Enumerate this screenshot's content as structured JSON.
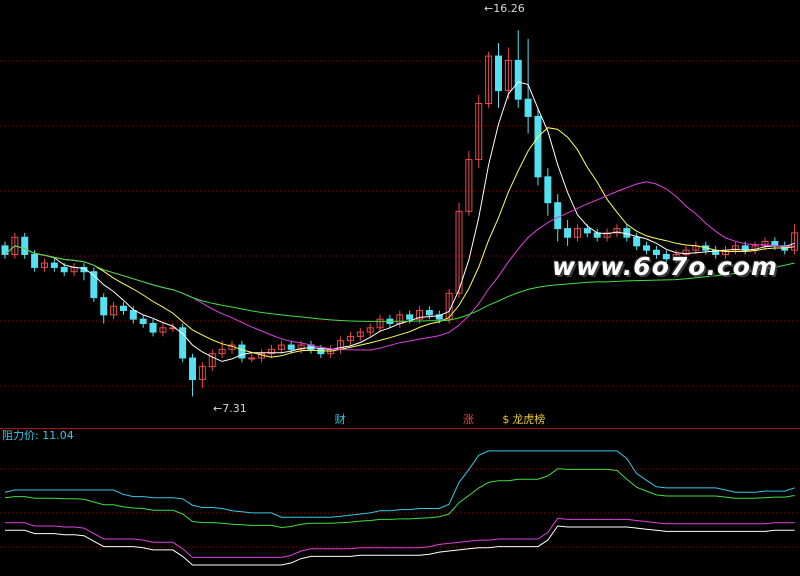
{
  "chart_data": {
    "type": "candlestick",
    "title": "",
    "price_range": [
      6.6,
      16.5
    ],
    "indicator": {
      "label": "阻力价",
      "value": "11.04",
      "range": [
        0,
        12.5
      ]
    },
    "annotations": {
      "high": "16.26",
      "low": "7.31"
    },
    "markers": [
      {
        "text": "财",
        "index": 34,
        "color": "#36c8e8"
      },
      {
        "text": "涨",
        "index": 47,
        "color": "#e84c4c"
      },
      {
        "text": "$",
        "index": 51,
        "color": "#e8c832"
      },
      {
        "text": "龙虎榜",
        "index": 52,
        "color": "#e8c832"
      }
    ],
    "series": [
      {
        "values": [
          [
            10.8,
            10.6,
            10.9,
            10.5
          ],
          [
            10.6,
            11.0,
            11.1,
            10.5
          ],
          [
            11.0,
            10.6,
            11.1,
            10.5
          ],
          [
            10.6,
            10.3,
            10.7,
            10.2
          ],
          [
            10.3,
            10.4,
            10.5,
            10.2
          ],
          [
            10.4,
            10.3,
            10.5,
            10.2
          ],
          [
            10.3,
            10.2,
            10.4,
            10.1
          ],
          [
            10.2,
            10.3,
            10.4,
            10.1
          ],
          [
            10.3,
            10.2,
            10.4,
            10.0
          ],
          [
            10.2,
            9.6,
            10.3,
            9.5
          ],
          [
            9.6,
            9.2,
            9.7,
            9.0
          ],
          [
            9.2,
            9.4,
            9.5,
            9.1
          ],
          [
            9.4,
            9.3,
            9.5,
            9.2
          ],
          [
            9.3,
            9.1,
            9.4,
            9.0
          ],
          [
            9.1,
            9.0,
            9.2,
            8.9
          ],
          [
            9.0,
            8.8,
            9.1,
            8.7
          ],
          [
            8.8,
            8.9,
            9.0,
            8.7
          ],
          [
            8.9,
            8.9,
            9.0,
            8.8
          ],
          [
            8.9,
            8.2,
            9.0,
            8.1
          ],
          [
            8.2,
            7.7,
            8.3,
            7.31
          ],
          [
            7.7,
            8.0,
            8.1,
            7.5
          ],
          [
            8.0,
            8.3,
            8.4,
            7.9
          ],
          [
            8.3,
            8.4,
            8.6,
            8.2
          ],
          [
            8.4,
            8.5,
            8.6,
            8.3
          ],
          [
            8.5,
            8.2,
            8.6,
            8.1
          ],
          [
            8.2,
            8.2,
            8.3,
            8.1
          ],
          [
            8.2,
            8.3,
            8.4,
            8.1
          ],
          [
            8.3,
            8.4,
            8.5,
            8.2
          ],
          [
            8.4,
            8.5,
            8.6,
            8.3
          ],
          [
            8.5,
            8.4,
            8.6,
            8.3
          ],
          [
            8.4,
            8.5,
            8.6,
            8.3
          ],
          [
            8.5,
            8.4,
            8.6,
            8.3
          ],
          [
            8.4,
            8.3,
            8.5,
            8.2
          ],
          [
            8.3,
            8.4,
            8.5,
            8.2
          ],
          [
            8.4,
            8.6,
            8.7,
            8.3
          ],
          [
            8.6,
            8.7,
            8.8,
            8.5
          ],
          [
            8.7,
            8.8,
            8.9,
            8.6
          ],
          [
            8.8,
            8.9,
            9.0,
            8.7
          ],
          [
            8.9,
            9.1,
            9.2,
            8.8
          ],
          [
            9.1,
            9.0,
            9.2,
            8.9
          ],
          [
            9.0,
            9.2,
            9.3,
            8.9
          ],
          [
            9.2,
            9.1,
            9.3,
            9.0
          ],
          [
            9.1,
            9.3,
            9.4,
            9.0
          ],
          [
            9.3,
            9.2,
            9.4,
            9.1
          ],
          [
            9.2,
            9.1,
            9.3,
            9.0
          ],
          [
            9.1,
            9.7,
            9.8,
            9.0
          ],
          [
            9.7,
            11.6,
            11.8,
            9.6
          ],
          [
            11.6,
            12.8,
            13.0,
            11.5
          ],
          [
            12.8,
            14.1,
            14.3,
            12.6
          ],
          [
            14.1,
            15.2,
            15.3,
            14.0
          ],
          [
            15.2,
            14.4,
            15.5,
            14.0
          ],
          [
            14.4,
            15.1,
            15.4,
            14.2
          ],
          [
            15.1,
            14.2,
            15.8,
            14.0
          ],
          [
            14.2,
            13.8,
            15.6,
            13.4
          ],
          [
            13.8,
            12.4,
            14.0,
            12.2
          ],
          [
            12.4,
            11.8,
            12.6,
            11.5
          ],
          [
            11.8,
            11.2,
            12.0,
            10.9
          ],
          [
            11.2,
            11.0,
            11.4,
            10.8
          ],
          [
            11.0,
            11.2,
            11.3,
            10.9
          ],
          [
            11.2,
            11.1,
            11.3,
            11.0
          ],
          [
            11.1,
            11.0,
            11.2,
            10.9
          ],
          [
            11.0,
            11.1,
            11.2,
            10.9
          ],
          [
            11.1,
            11.2,
            11.3,
            11.0
          ],
          [
            11.2,
            11.0,
            11.3,
            10.9
          ],
          [
            11.0,
            10.8,
            11.1,
            10.7
          ],
          [
            10.8,
            10.7,
            10.9,
            10.6
          ],
          [
            10.7,
            10.6,
            10.8,
            10.5
          ],
          [
            10.6,
            10.5,
            10.7,
            10.4
          ],
          [
            10.5,
            10.6,
            10.7,
            10.4
          ],
          [
            10.6,
            10.7,
            10.8,
            10.5
          ],
          [
            10.7,
            10.8,
            10.9,
            10.6
          ],
          [
            10.8,
            10.7,
            10.9,
            10.6
          ],
          [
            10.7,
            10.6,
            10.8,
            10.5
          ],
          [
            10.6,
            10.7,
            10.8,
            10.5
          ],
          [
            10.7,
            10.8,
            10.9,
            10.6
          ],
          [
            10.8,
            10.7,
            10.9,
            10.6
          ],
          [
            10.7,
            10.8,
            10.9,
            10.6
          ],
          [
            10.8,
            10.9,
            11.0,
            10.7
          ],
          [
            10.9,
            10.8,
            11.0,
            10.7
          ],
          [
            10.8,
            10.7,
            10.9,
            10.6
          ],
          [
            10.7,
            11.1,
            11.3,
            10.6
          ]
        ]
      },
      {
        "values": []
      },
      {
        "values": []
      },
      {
        "values": []
      },
      {
        "values": []
      },
      {
        "values": []
      },
      {
        "values": []
      }
    ]
  },
  "colors": {
    "rise": "#e84c4c",
    "fall": "#54e0f0",
    "ma5": "#ffffff",
    "ma10": "#ffff5a",
    "ma20": "#e040e0",
    "ma60": "#40e040",
    "ind_cyan": "#36c8e8",
    "ind_green": "#40e040",
    "ind_white": "#ffffff",
    "ind_magenta": "#e040e0",
    "grid": "#8b0000"
  },
  "watermark": "www.6o7o.com"
}
